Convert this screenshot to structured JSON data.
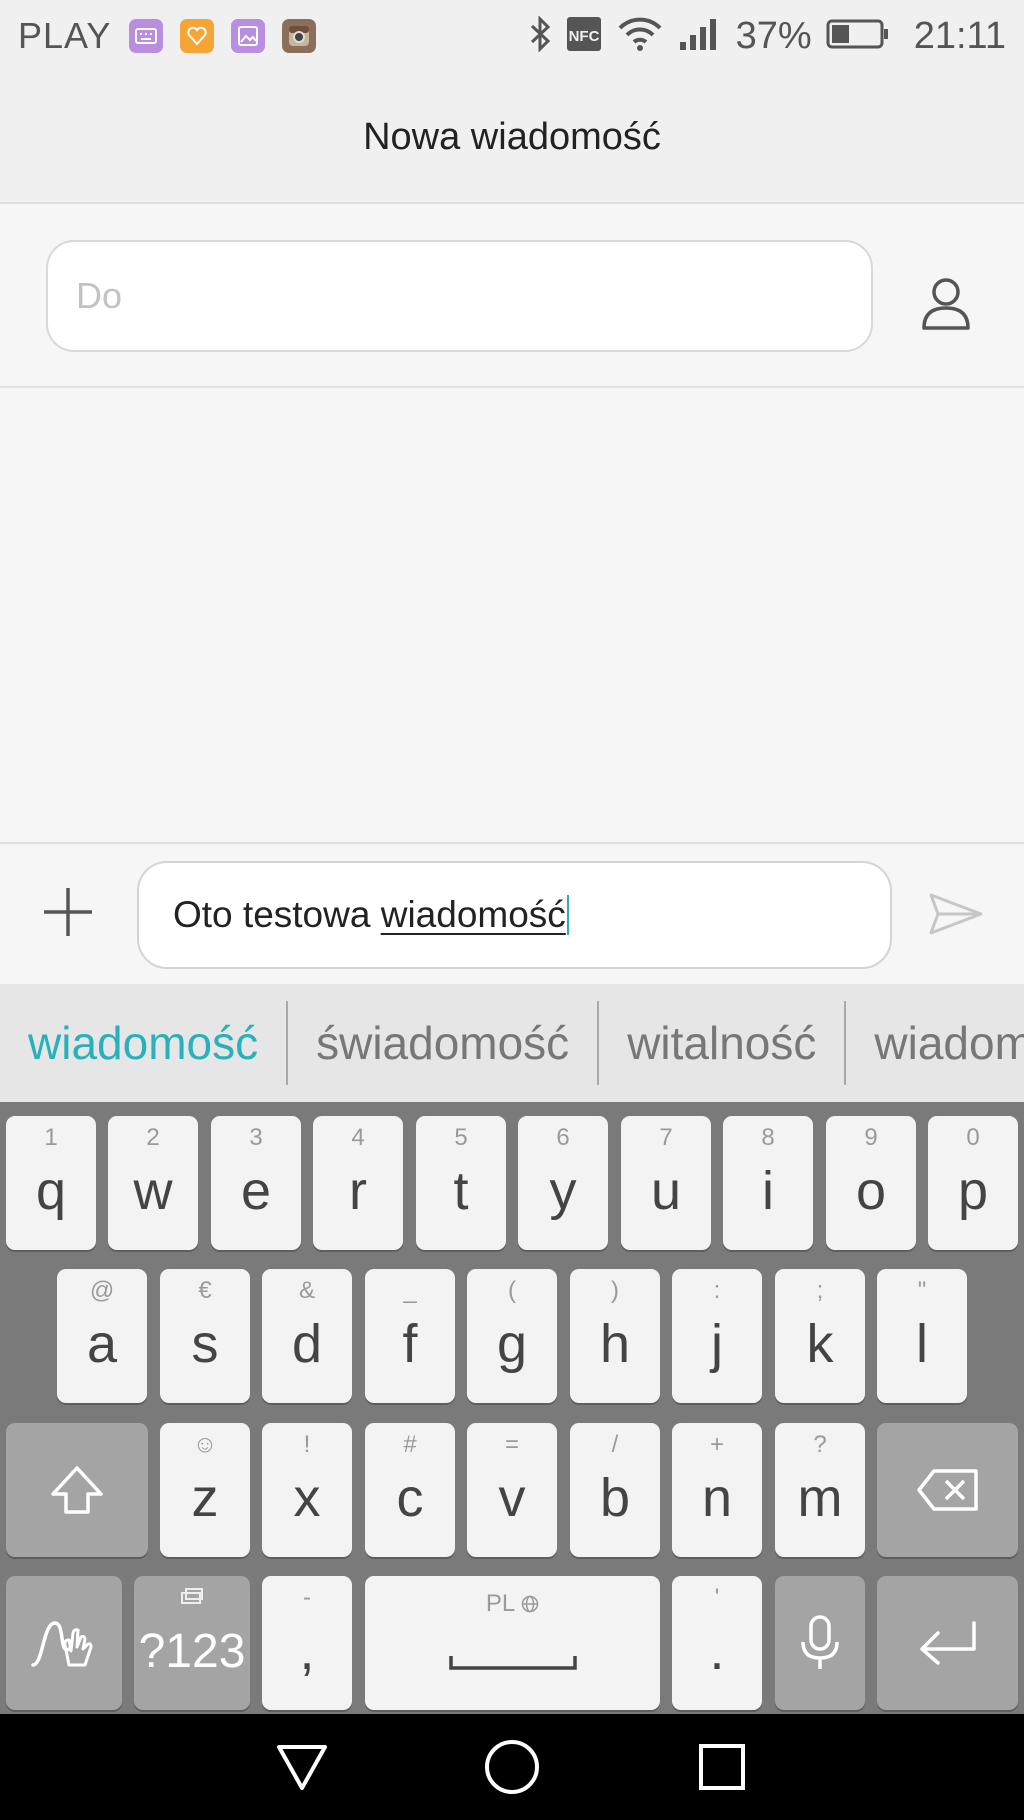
{
  "status_bar": {
    "carrier": "PLAY",
    "notification_icons": [
      "keyboard-app-icon",
      "heart-app-icon",
      "gallery-app-icon",
      "instagram-app-icon"
    ],
    "status_icons": [
      "bluetooth-icon",
      "nfc-icon",
      "wifi-icon",
      "signal-icon"
    ],
    "nfc_text": "NFC",
    "battery_percent": "37%",
    "battery_level": 0.37,
    "time": "21:11"
  },
  "header": {
    "title": "Nowa wiadomość"
  },
  "recipient": {
    "placeholder": "Do",
    "value": ""
  },
  "compose": {
    "text_prefix": "Oto testowa ",
    "text_composing": "wiadomość",
    "attach_icon": "plus-icon",
    "send_icon": "send-icon"
  },
  "suggestions": [
    "wiadomość",
    "świadomość",
    "witalność",
    "wiadomości"
  ],
  "keyboard": {
    "row1": [
      {
        "hint": "1",
        "label": "q"
      },
      {
        "hint": "2",
        "label": "w"
      },
      {
        "hint": "3",
        "label": "e"
      },
      {
        "hint": "4",
        "label": "r"
      },
      {
        "hint": "5",
        "label": "t"
      },
      {
        "hint": "6",
        "label": "y"
      },
      {
        "hint": "7",
        "label": "u"
      },
      {
        "hint": "8",
        "label": "i"
      },
      {
        "hint": "9",
        "label": "o"
      },
      {
        "hint": "0",
        "label": "p"
      }
    ],
    "row2": [
      {
        "hint": "@",
        "label": "a"
      },
      {
        "hint": "€",
        "label": "s"
      },
      {
        "hint": "&",
        "label": "d"
      },
      {
        "hint": "_",
        "label": "f"
      },
      {
        "hint": "(",
        "label": "g"
      },
      {
        "hint": ")",
        "label": "h"
      },
      {
        "hint": ":",
        "label": "j"
      },
      {
        "hint": ";",
        "label": "k"
      },
      {
        "hint": "\"",
        "label": "l"
      }
    ],
    "row3": [
      {
        "hint": "☺",
        "label": "z"
      },
      {
        "hint": "!",
        "label": "x"
      },
      {
        "hint": "#",
        "label": "c"
      },
      {
        "hint": "=",
        "label": "v"
      },
      {
        "hint": "/",
        "label": "b"
      },
      {
        "hint": "+",
        "label": "n"
      },
      {
        "hint": "?",
        "label": "m"
      }
    ],
    "symbols_label": "?123",
    "comma": {
      "hint": "-",
      "label": ","
    },
    "space_label": "PL",
    "period": {
      "hint": "'",
      "label": "."
    },
    "icons": {
      "shift": "shift-icon",
      "backspace": "backspace-icon",
      "swipe": "swipe-typing-icon",
      "mic": "microphone-icon",
      "enter": "enter-icon",
      "globe": "globe-icon"
    }
  },
  "nav_bar": {
    "icons": [
      "back-icon",
      "home-icon",
      "recents-icon"
    ]
  }
}
